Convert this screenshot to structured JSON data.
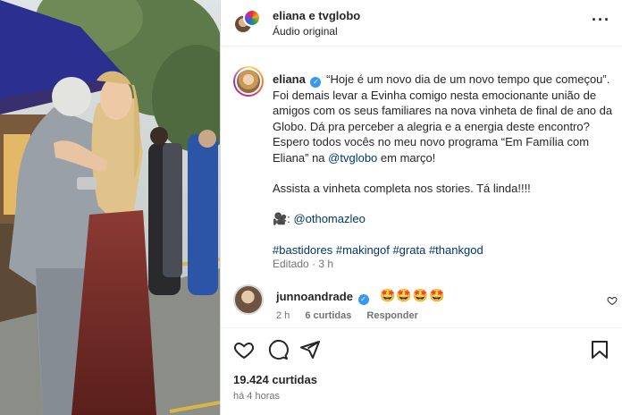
{
  "header": {
    "title": "eliana e tvglobo",
    "subtitle": "Áudio original",
    "more_icon": "more-horizontal-icon"
  },
  "caption": {
    "username": "eliana",
    "line1": "“Hoje é um novo dia de um novo tempo que começou”.",
    "line2": "Foi demais levar a Evinha comigo nesta emocionante união de",
    "line3": "amigos com os seus familiares na nova vinheta de final de ano da",
    "line4": "Globo. Dá pra perceber a alegria e a energia deste encontro?",
    "line5": "Espero todos vocês no meu novo programa “Em Família com",
    "line6_pre": "Eliana” na ",
    "line6_mention": "@tvglobo",
    "line6_post": " em março!",
    "para2": "Assista a vinheta completa nos stories. Tá linda!!!!",
    "camera_emoji": "🎥:",
    "camera_mention": "@othomazleo",
    "hashtags": [
      "#bastidores",
      "#makingof",
      "#grata",
      "#thankgod"
    ],
    "edited": "Editado · 3 h"
  },
  "comment": {
    "username": "junnoandrade",
    "text": "🤩🤩🤩🤩",
    "age": "2 h",
    "likes": "6 curtidas",
    "reply": "Responder"
  },
  "stats": {
    "likes": "19.424 curtidas",
    "time": "há 4 horas"
  },
  "icons": {
    "like": "heart-icon",
    "comment": "comment-icon",
    "share": "send-icon",
    "save": "bookmark-icon"
  },
  "colors": {
    "link": "#00376b",
    "verified": "#3897f0",
    "secondary_text": "#737373"
  }
}
